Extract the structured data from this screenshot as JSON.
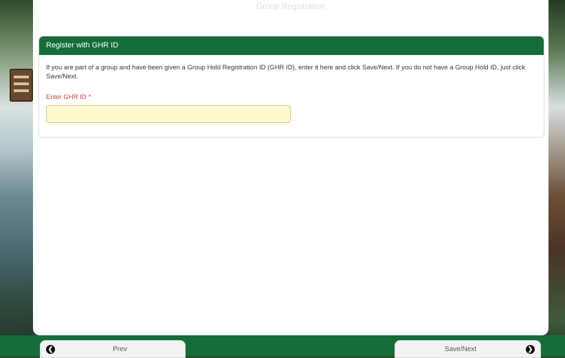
{
  "page": {
    "heading": "Group Registration"
  },
  "panel": {
    "title": "Register with GHR ID",
    "instructions": "If you are part of a group and have been given a Group Hold Registration ID (GHR ID), enter it here and click Save/Next. If you do not have a Group Hold ID, just click Save/Next.",
    "field_label": "Enter GHR ID",
    "required_marker": "*",
    "field_value": ""
  },
  "footer": {
    "prev_label": "Prev",
    "next_label": "Save/Next",
    "prev_icon": "arrow-left-circle-icon",
    "next_icon": "arrow-right-circle-icon"
  },
  "colors": {
    "brand_green": "#156d39",
    "input_bg": "#fff8cf",
    "required_red": "#d23b3b"
  }
}
